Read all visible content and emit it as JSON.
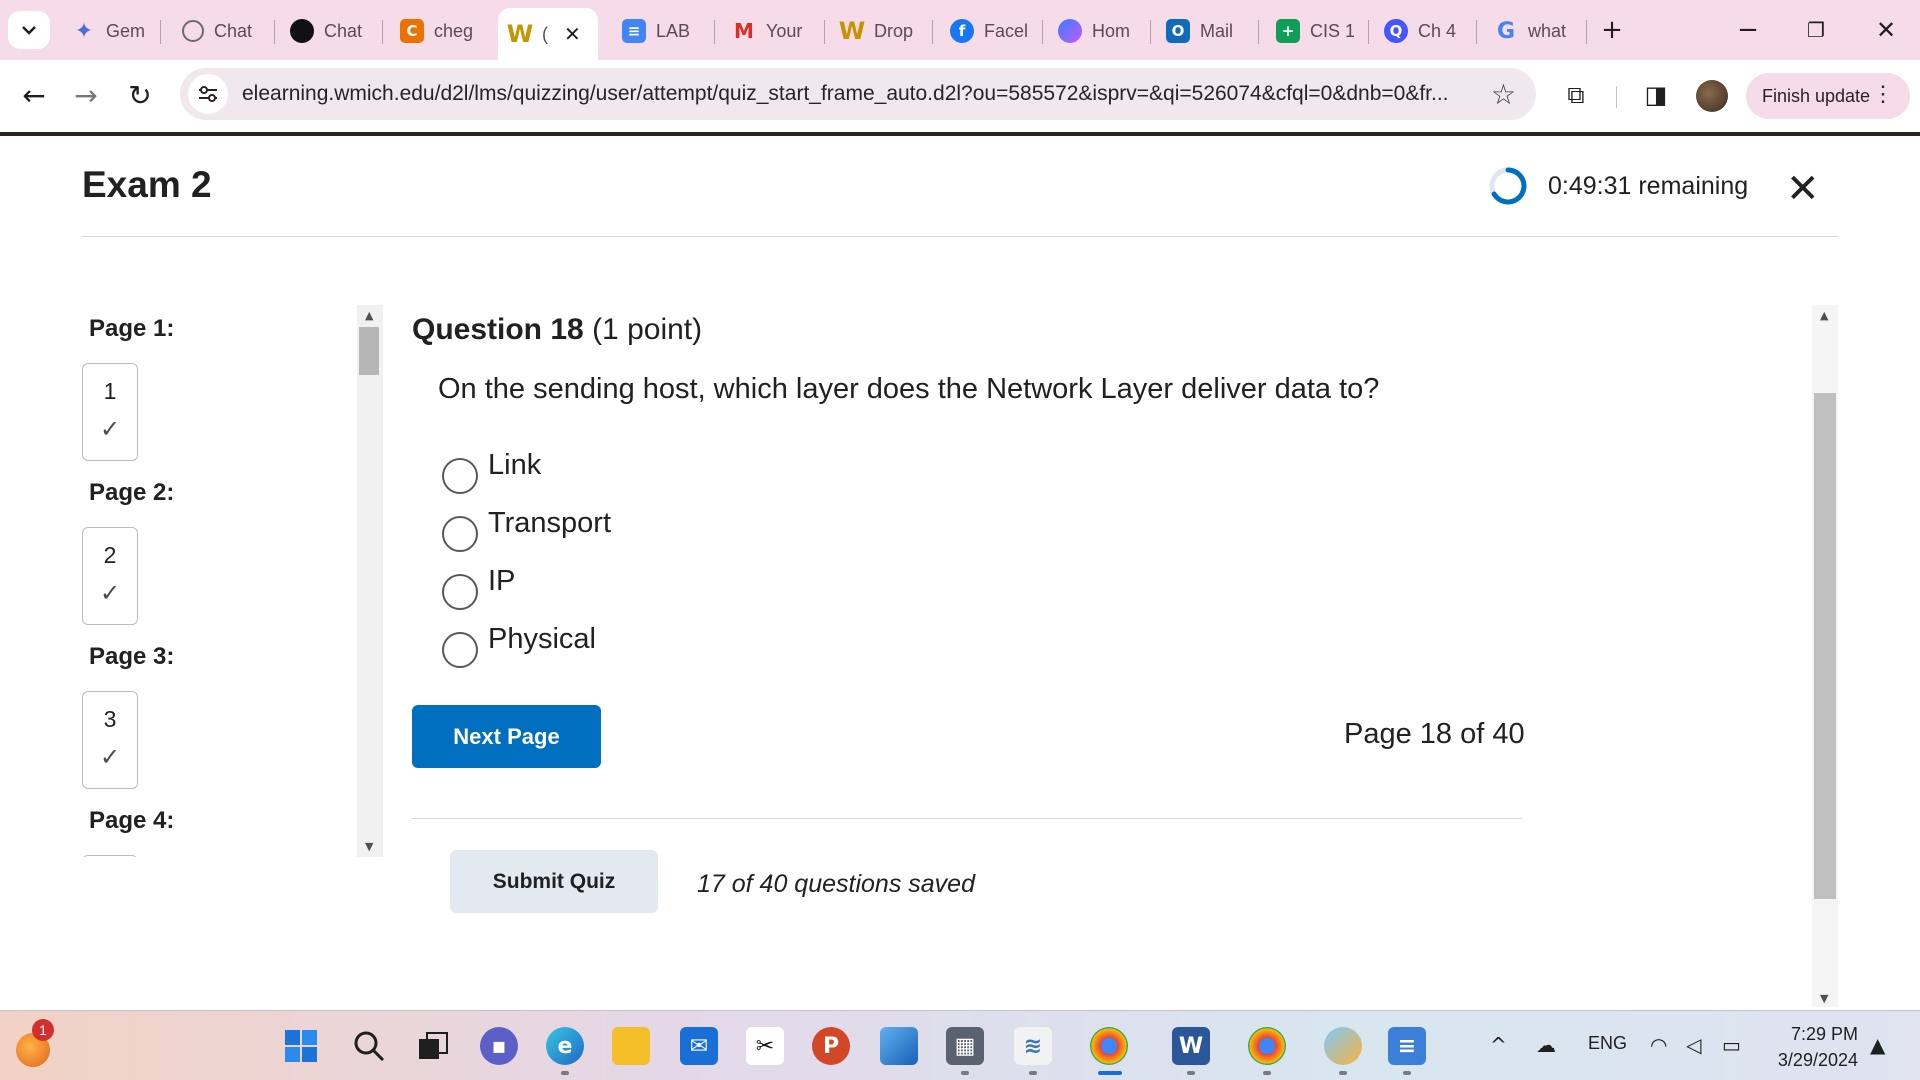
{
  "browser": {
    "tabs": [
      {
        "title": "Gem",
        "icon": "gemini-icon"
      },
      {
        "title": "Chat",
        "icon": "chatgpt-icon"
      },
      {
        "title": "Chat",
        "icon": "chat-ai-icon"
      },
      {
        "title": "cheg",
        "icon": "chegg-icon"
      },
      {
        "title": "(",
        "icon": "wmich-icon",
        "active": true
      },
      {
        "title": "LAB",
        "icon": "docs-icon"
      },
      {
        "title": "Your",
        "icon": "gmail-icon"
      },
      {
        "title": "Drop",
        "icon": "wmich-icon"
      },
      {
        "title": "Facel",
        "icon": "facebook-icon"
      },
      {
        "title": "Hom",
        "icon": "copilot-icon"
      },
      {
        "title": "Mail",
        "icon": "outlook-icon"
      },
      {
        "title": "CIS 1",
        "icon": "sheets-icon"
      },
      {
        "title": "Ch 4",
        "icon": "quizlet-icon"
      },
      {
        "title": "what",
        "icon": "google-icon"
      }
    ],
    "url": "elearning.wmich.edu/d2l/lms/quizzing/user/attempt/quiz_start_frame_auto.d2l?ou=585572&isprv=&qi=526074&cfql=0&dnb=0&fr...",
    "finish_update_label": "Finish update"
  },
  "quiz": {
    "title": "Exam 2",
    "time_remaining": "0:49:31 remaining",
    "nav_pages": [
      {
        "heading": "Page 1:",
        "number": "1",
        "answered": true
      },
      {
        "heading": "Page 2:",
        "number": "2",
        "answered": true
      },
      {
        "heading": "Page 3:",
        "number": "3",
        "answered": true
      },
      {
        "heading": "Page 4:",
        "number": "",
        "answered": false
      }
    ],
    "question": {
      "label": "Question 18",
      "points": "(1 point)",
      "text": "On the sending host, which layer does the Network Layer deliver data to?",
      "options": [
        "Link",
        "Transport",
        "IP",
        "Physical"
      ],
      "selected": null
    },
    "next_button_label": "Next Page",
    "page_status": "Page 18 of 40",
    "submit_button_label": "Submit Quiz",
    "saved_status": "17 of 40 questions saved"
  },
  "taskbar": {
    "notification_badge": "1",
    "language": "ENG",
    "time": "7:29 PM",
    "date": "3/29/2024"
  },
  "colors": {
    "accent": "#006fbf",
    "tab_strip": "#f6dbe8",
    "submit_bg": "#e3e9f1"
  }
}
